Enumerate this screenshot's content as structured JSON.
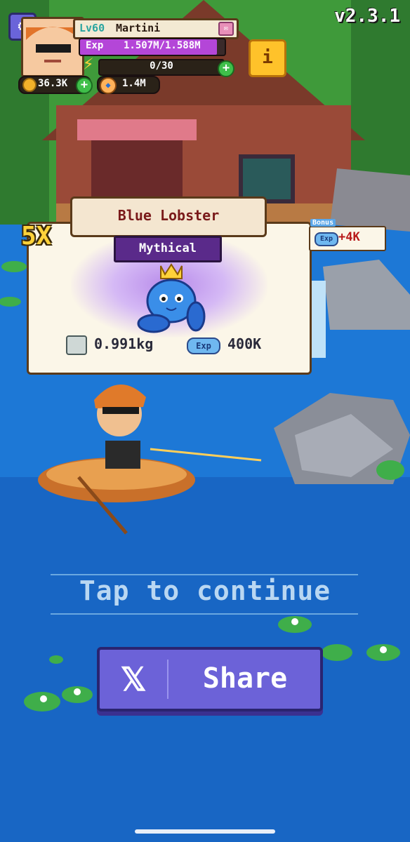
{
  "version": "v2.3.1",
  "player": {
    "level": "Lv60",
    "name": "Martini",
    "exp_label": "Exp",
    "exp": "1.507M/1.588M",
    "exp_fraction": 0.949,
    "energy": "0/30",
    "coins": "36.3K",
    "fish_currency": "1.4M"
  },
  "catch": {
    "multiplier": "5X",
    "fish_name": "Blue Lobster",
    "rarity": "Mythical",
    "weight": "0.991kg",
    "exp_tag": "Exp",
    "exp_reward": "400K"
  },
  "bonus": {
    "tag": "Bonus",
    "exp_tag": "Exp",
    "value": "+4K"
  },
  "prompt": "Tap to continue",
  "share": {
    "icon": "x-logo-icon",
    "label": "Share"
  },
  "colors": {
    "water": "#1a6fd0",
    "rarity_mythical": "#5a2a8a",
    "share_button": "#6c62d8",
    "accent_gold": "#ffc22a"
  }
}
